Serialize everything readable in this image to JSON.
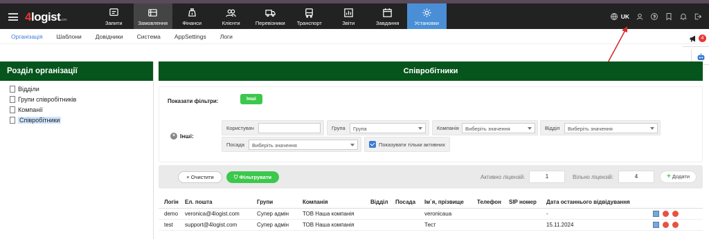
{
  "brand": {
    "logo_text": "4logist",
    "logo_sub": ".com"
  },
  "nav": {
    "items": [
      {
        "label": "Запити",
        "icon": "requests-icon"
      },
      {
        "label": "Замовлення",
        "icon": "orders-icon"
      },
      {
        "label": "Фінанси",
        "icon": "finance-icon"
      },
      {
        "label": "Клієнти",
        "icon": "clients-icon"
      },
      {
        "label": "Перевізники",
        "icon": "truck-icon"
      },
      {
        "label": "Транспорт",
        "icon": "transport-icon"
      },
      {
        "label": "Звіти",
        "icon": "reports-icon"
      },
      {
        "label": "Завдання",
        "icon": "calendar-icon"
      },
      {
        "label": "Установки",
        "icon": "gear-icon"
      }
    ],
    "lang": "UK",
    "right_icons": [
      "globe-icon",
      "user-icon",
      "coin-icon",
      "bookmark-icon",
      "bell-icon",
      "logout-icon"
    ]
  },
  "subnav": {
    "items": [
      "Організація",
      "Шаблони",
      "Довідники",
      "Система",
      "AppSettings",
      "Логи"
    ]
  },
  "notifications": {
    "count": "4"
  },
  "left_panel": {
    "title": "Розділ організації",
    "items": [
      "Відділи",
      "Групи співробітників",
      "Компанії",
      "Співробітники"
    ]
  },
  "main": {
    "title": "Співробітники",
    "filters": {
      "show_label": "Показати фільтри:",
      "other_button": "Інші",
      "other_label": "Інші:",
      "user_label": "Користувач",
      "user_value": "",
      "group_label": "Група",
      "group_value": "Група",
      "company_label": "Компанія",
      "company_placeholder": "Виберіть значення",
      "dept_label": "Відділ",
      "dept_placeholder": "Виберіть значення",
      "position_label": "Посада",
      "position_placeholder": "Виберіть значення",
      "active_only_label": "Показувати тільки активних"
    },
    "actions": {
      "clear": "Очистити",
      "filter": "Фільтрувати",
      "active_licenses_label": "Активно ліцензій:",
      "active_licenses": "1",
      "free_licenses_label": "Вільно ліцензій:",
      "free_licenses": "4",
      "add": "Додати"
    },
    "table": {
      "columns": [
        "Логін",
        "Ел. пошта",
        "Групи",
        "Компанія",
        "Відділ",
        "Посада",
        "Ім`я, прізвище",
        "Телефон",
        "SIP номер",
        "Дата останнього відвідування"
      ],
      "rows": [
        [
          "demo",
          "veronica@4logist.com",
          "Супер адмін",
          "ТОВ Наша компанія",
          "",
          "",
          "veronicaua",
          "",
          "",
          "-"
        ],
        [
          "test",
          "support@4logist.com",
          "Супер адмін",
          "ТОВ Наша компанія",
          "",
          "",
          "Тест",
          "",
          "",
          "15.11.2024"
        ]
      ]
    }
  }
}
